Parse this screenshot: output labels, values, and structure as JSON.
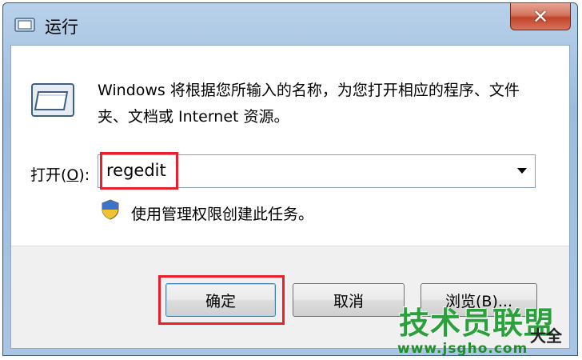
{
  "window": {
    "title": "运行",
    "close_label": "✕"
  },
  "content": {
    "description": "Windows 将根据您所输入的名称，为您打开相应的程序、文件夹、文档或 Internet 资源。",
    "open_label_prefix": "打开(",
    "open_label_key": "O",
    "open_label_suffix": "):",
    "open_value": "regedit",
    "admin_text": "使用管理权限创建此任务。"
  },
  "buttons": {
    "ok": "确定",
    "cancel": "取消",
    "browse": "浏览(B)..."
  },
  "watermark": {
    "main": "技术员联盟",
    "side": "大全",
    "url": "www.jsgho.com"
  },
  "colors": {
    "highlight": "#e8202a",
    "watermark_green": "#2aa13a"
  },
  "icons": {
    "title": "run-icon",
    "main": "run-icon",
    "shield": "uac-shield-icon",
    "close": "close-icon",
    "dropdown": "chevron-down-icon"
  }
}
